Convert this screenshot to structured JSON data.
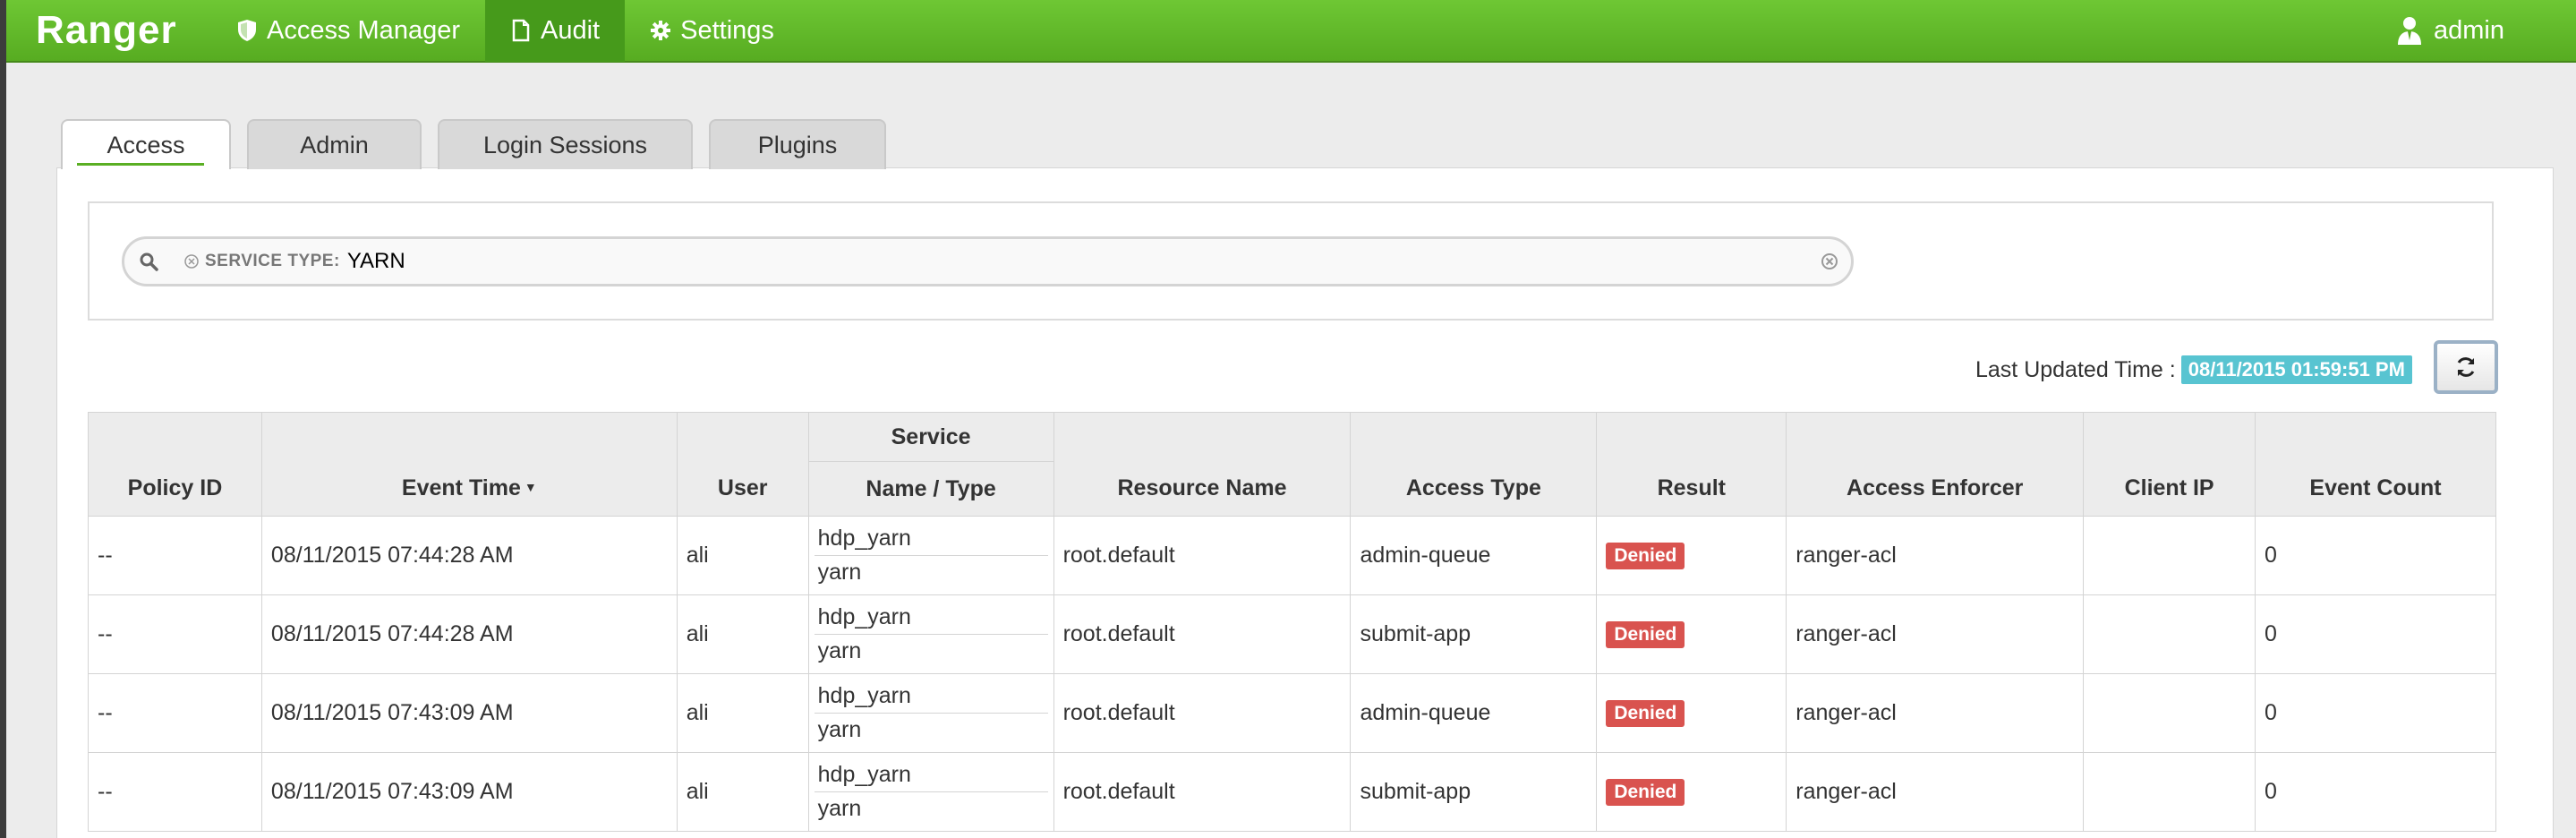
{
  "nav": {
    "brand": "Ranger",
    "items": [
      {
        "label": "Access Manager",
        "icon": "shield-icon"
      },
      {
        "label": "Audit",
        "icon": "document-icon"
      },
      {
        "label": "Settings",
        "icon": "gear-icon"
      }
    ],
    "user": "admin"
  },
  "tabs": [
    "Access",
    "Admin",
    "Login Sessions",
    "Plugins"
  ],
  "search": {
    "facet_label": "SERVICE TYPE:",
    "facet_value": "YARN"
  },
  "last_updated": {
    "label": "Last Updated Time :",
    "value": "08/11/2015 01:59:51 PM"
  },
  "table": {
    "headers": {
      "policy_id": "Policy ID",
      "event_time": "Event Time",
      "user": "User",
      "service_group": "Service",
      "service_sub": "Name / Type",
      "resource": "Resource Name",
      "access_type": "Access Type",
      "result": "Result",
      "enforcer": "Access Enforcer",
      "client_ip": "Client IP",
      "event_count": "Event Count"
    },
    "rows": [
      {
        "policy_id": "--",
        "event_time": "08/11/2015 07:44:28 AM",
        "user": "ali",
        "service_name": "hdp_yarn",
        "service_type": "yarn",
        "resource": "root.default",
        "access_type": "admin-queue",
        "result": "Denied",
        "enforcer": "ranger-acl",
        "client_ip": "",
        "event_count": "0"
      },
      {
        "policy_id": "--",
        "event_time": "08/11/2015 07:44:28 AM",
        "user": "ali",
        "service_name": "hdp_yarn",
        "service_type": "yarn",
        "resource": "root.default",
        "access_type": "submit-app",
        "result": "Denied",
        "enforcer": "ranger-acl",
        "client_ip": "",
        "event_count": "0"
      },
      {
        "policy_id": "--",
        "event_time": "08/11/2015 07:43:09 AM",
        "user": "ali",
        "service_name": "hdp_yarn",
        "service_type": "yarn",
        "resource": "root.default",
        "access_type": "admin-queue",
        "result": "Denied",
        "enforcer": "ranger-acl",
        "client_ip": "",
        "event_count": "0"
      },
      {
        "policy_id": "--",
        "event_time": "08/11/2015 07:43:09 AM",
        "user": "ali",
        "service_name": "hdp_yarn",
        "service_type": "yarn",
        "resource": "root.default",
        "access_type": "submit-app",
        "result": "Denied",
        "enforcer": "ranger-acl",
        "client_ip": "",
        "event_count": "0"
      }
    ]
  },
  "colors": {
    "nav_green": "#5fb82a",
    "denied": "#d9534f",
    "time_badge": "#58c4d1"
  }
}
